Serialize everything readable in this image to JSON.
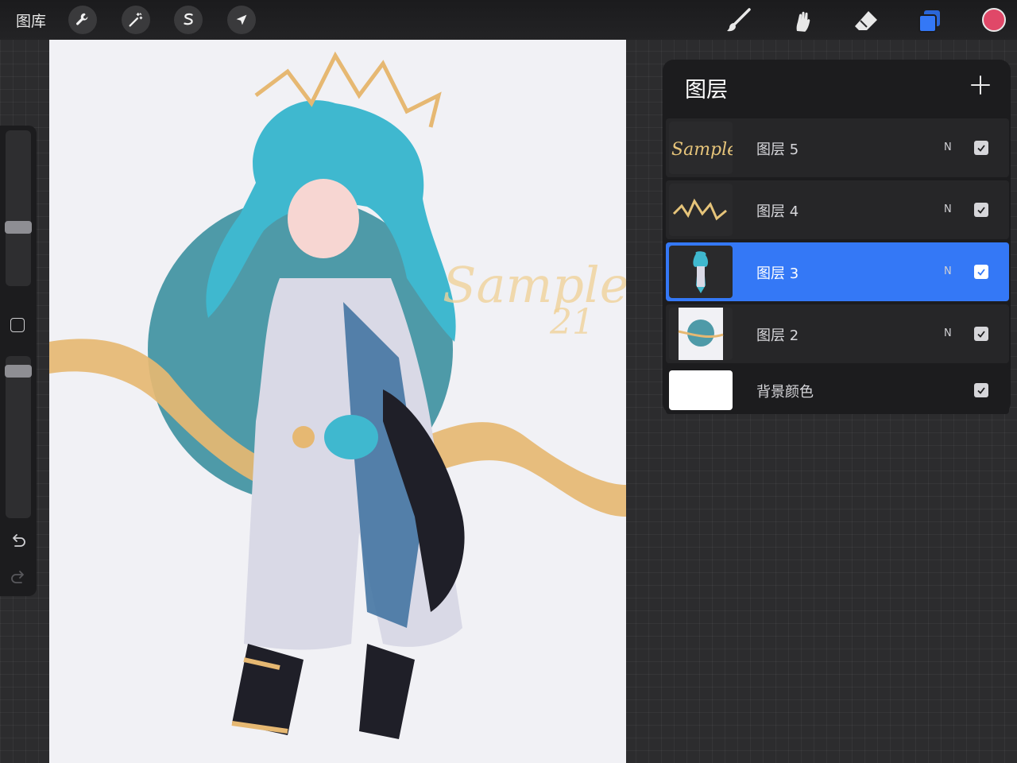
{
  "toolbar": {
    "gallery_label": "图库",
    "actions_icon": "wrench-icon",
    "adjustments_icon": "magic-wand-icon",
    "selection_icon": "selection-s-icon",
    "transform_icon": "arrow-cursor-icon",
    "brush_icon": "brush-icon",
    "smudge_icon": "smudge-icon",
    "eraser_icon": "eraser-icon",
    "layers_icon": "layers-icon",
    "active_color": "#e04868"
  },
  "canvas": {
    "watermark_line1": "Sample",
    "watermark_line2": "21"
  },
  "sidebar": {
    "brush_size_level": 0.62,
    "opacity_level": 0.96
  },
  "layers": {
    "title": "图层",
    "items": [
      {
        "name": "图层 5",
        "blend": "N",
        "visible": true,
        "selected": false
      },
      {
        "name": "图层 4",
        "blend": "N",
        "visible": true,
        "selected": false
      },
      {
        "name": "图层 3",
        "blend": "N",
        "visible": true,
        "selected": true
      },
      {
        "name": "图层 2",
        "blend": "N",
        "visible": true,
        "selected": false
      },
      {
        "name": "背景颜色",
        "blend": "",
        "visible": true,
        "selected": false
      }
    ]
  },
  "colors": {
    "accent": "#3478f6",
    "teal_circle": "#4e9aa8",
    "gold": "#e6b872",
    "hair": "#3fb8cf"
  }
}
